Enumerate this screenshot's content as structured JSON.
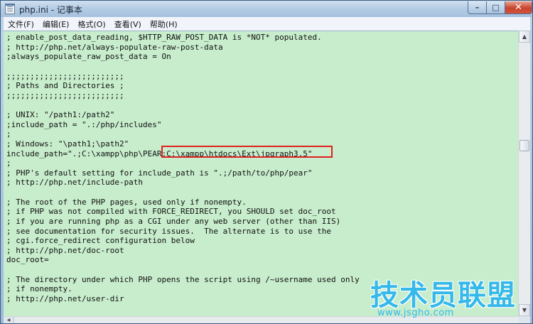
{
  "window": {
    "title": "php.ini - 记事本",
    "icon": "notepad-icon",
    "controls": {
      "minimize": "–",
      "maximize": "□",
      "close": "✕"
    }
  },
  "menu": [
    {
      "label": "文件(F)"
    },
    {
      "label": "编辑(E)"
    },
    {
      "label": "格式(O)"
    },
    {
      "label": "查看(V)"
    },
    {
      "label": "帮助(H)"
    }
  ],
  "editor": {
    "background": "#c7edcc",
    "highlight_color": "#e02020",
    "lines": [
      "; enable_post_data_reading, $HTTP_RAW_POST_DATA is *NOT* populated.",
      "; http://php.net/always-populate-raw-post-data",
      ";always_populate_raw_post_data = On",
      "",
      ";;;;;;;;;;;;;;;;;;;;;;;;;",
      "; Paths and Directories ;",
      ";;;;;;;;;;;;;;;;;;;;;;;;;",
      "",
      "; UNIX: \"/path1:/path2\"",
      ";include_path = \".:/php/includes\"",
      ";",
      "; Windows: \"\\path1;\\path2\"",
      "include_path=\".;C:\\xampp\\php\\PEAR;C:\\xampp\\htdocs\\Ext\\jpgraph3.5\"",
      ";",
      "; PHP's default setting for include_path is \".;/path/to/php/pear\"",
      "; http://php.net/include-path",
      "",
      "; The root of the PHP pages, used only if nonempty.",
      "; if PHP was not compiled with FORCE_REDIRECT, you SHOULD set doc_root",
      "; if you are running php as a CGI under any web server (other than IIS)",
      "; see documentation for security issues.  The alternate is to use the",
      "; cgi.force_redirect configuration below",
      "; http://php.net/doc-root",
      "doc_root=",
      "",
      "; The directory under which PHP opens the script using /~username used only",
      "; if nonempty.",
      "; http://php.net/user-dir"
    ]
  },
  "watermark": {
    "title": "技术员联盟",
    "url": "www.jsgho.com",
    "color": "#35b8ea"
  }
}
